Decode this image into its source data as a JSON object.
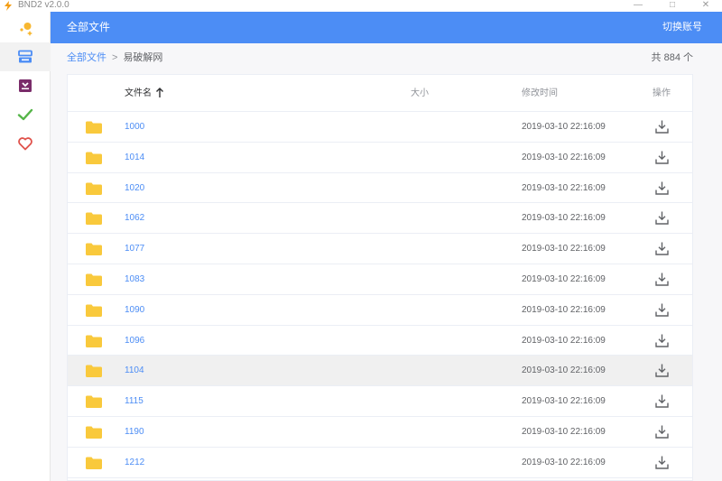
{
  "window": {
    "title": "BND2 v2.0.0",
    "controls": {
      "minimize": "—",
      "maximize": "□",
      "close": "✕"
    }
  },
  "colors": {
    "primary": "#4c8df5",
    "folder": "#f9c93c",
    "check": "#55b548",
    "heart": "#e0534c",
    "logo": "#f7b731"
  },
  "sidebar": {
    "items": [
      {
        "icon": "sparkle-logo-icon",
        "active": false
      },
      {
        "icon": "stack-drive-icon",
        "active": true
      },
      {
        "icon": "inbox-download-icon",
        "active": false
      },
      {
        "icon": "checkmark-icon",
        "active": false
      },
      {
        "icon": "heart-icon",
        "active": false
      }
    ]
  },
  "header": {
    "title": "全部文件",
    "switch_account": "切换账号"
  },
  "breadcrumb": {
    "root": "全部文件",
    "separator": ">",
    "current": "易破解网"
  },
  "total_label": "共 884 个",
  "table": {
    "columns": {
      "name": "文件名",
      "size": "大小",
      "modified": "修改时间",
      "action": "操作"
    },
    "rows": [
      {
        "name": "1000",
        "size": "",
        "modified": "2019-03-10 22:16:09"
      },
      {
        "name": "1014",
        "size": "",
        "modified": "2019-03-10 22:16:09"
      },
      {
        "name": "1020",
        "size": "",
        "modified": "2019-03-10 22:16:09"
      },
      {
        "name": "1062",
        "size": "",
        "modified": "2019-03-10 22:16:09"
      },
      {
        "name": "1077",
        "size": "",
        "modified": "2019-03-10 22:16:09"
      },
      {
        "name": "1083",
        "size": "",
        "modified": "2019-03-10 22:16:09"
      },
      {
        "name": "1090",
        "size": "",
        "modified": "2019-03-10 22:16:09"
      },
      {
        "name": "1096",
        "size": "",
        "modified": "2019-03-10 22:16:09"
      },
      {
        "name": "1104",
        "size": "",
        "modified": "2019-03-10 22:16:09",
        "hovered": true
      },
      {
        "name": "1115",
        "size": "",
        "modified": "2019-03-10 22:16:09"
      },
      {
        "name": "1190",
        "size": "",
        "modified": "2019-03-10 22:16:09"
      },
      {
        "name": "1212",
        "size": "",
        "modified": "2019-03-10 22:16:09"
      }
    ]
  }
}
